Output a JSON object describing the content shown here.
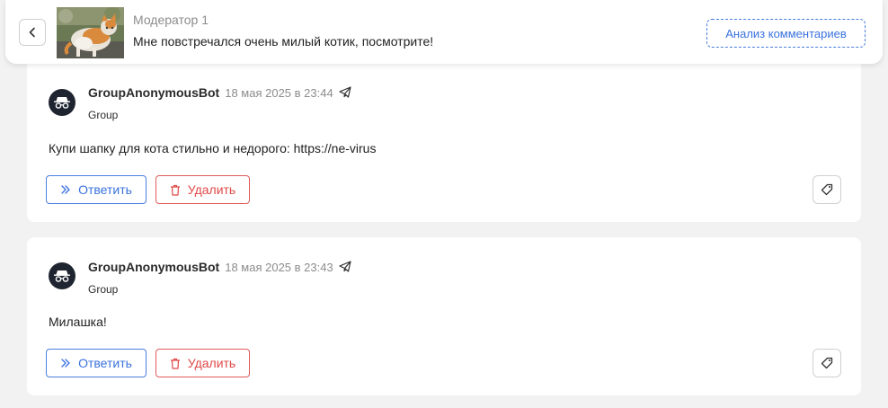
{
  "header": {
    "post_author": "Модератор 1",
    "post_title": "Мне повстречался очень милый котик, посмотрите!",
    "analyze_label": "Анализ комментариев",
    "back_icon": "chevron-left-icon",
    "thumbnail": "cat-photo"
  },
  "colors": {
    "primary": "#3a72dd",
    "danger": "#e04848",
    "avatar_bg": "#1f2530",
    "page_bg": "#f2f2f2"
  },
  "comments": [
    {
      "author": "GroupAnonymousBot",
      "date": "18 мая 2025 в 23:44",
      "group": "Group",
      "text": "Купи шапку для кота стильно и недорого: https://ne-virus",
      "reply_label": "Ответить",
      "delete_label": "Удалить"
    },
    {
      "author": "GroupAnonymousBot",
      "date": "18 мая 2025 в 23:43",
      "group": "Group",
      "text": "Милашка!",
      "reply_label": "Ответить",
      "delete_label": "Удалить"
    }
  ]
}
